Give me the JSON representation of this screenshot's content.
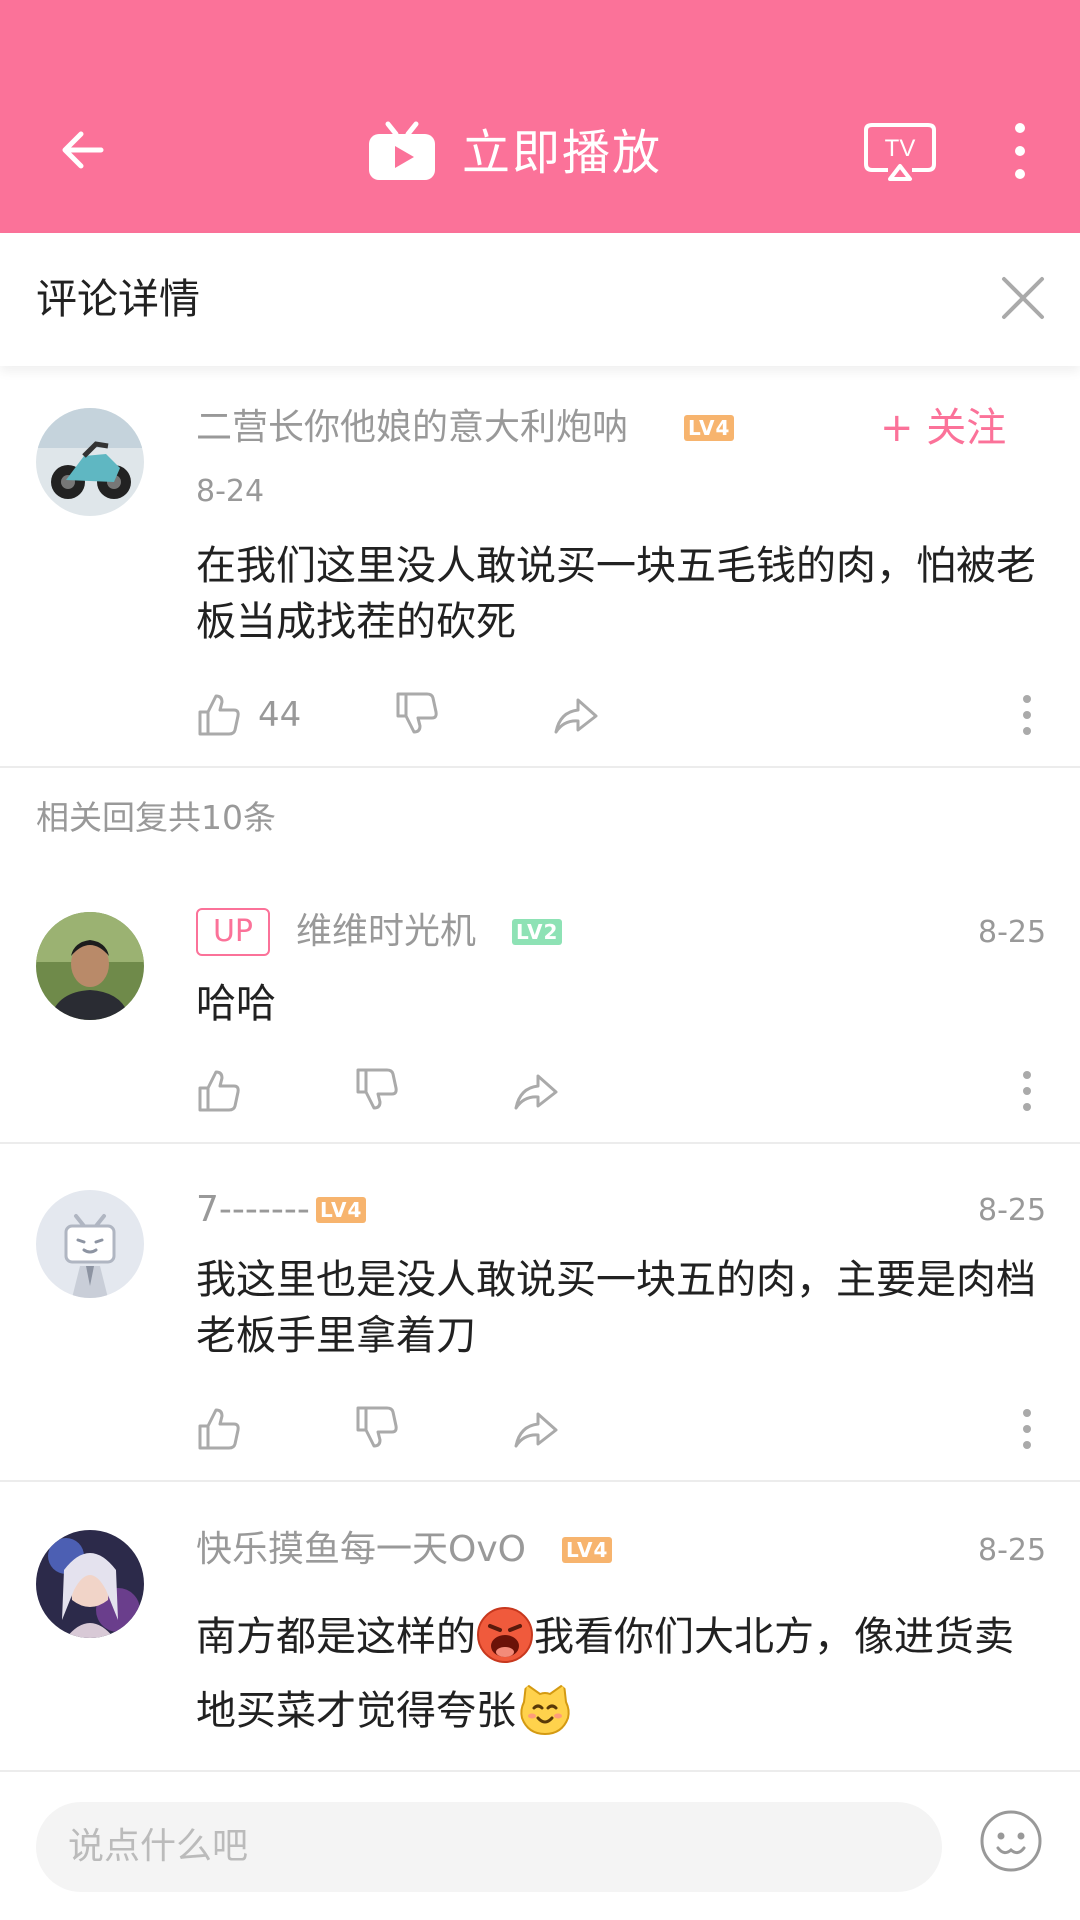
{
  "topbar": {
    "play_label": "立即播放",
    "tv_label": "TV",
    "accent": "#fb7299"
  },
  "header": {
    "title": "评论详情"
  },
  "main_comment": {
    "username": "二营长你他娘的意大利炮呐",
    "level": "LV4",
    "follow_label": "+ 关注",
    "date": "8-24",
    "text": "在我们这里没人敢说买一块五毛钱的肉，怕被老板当成找茬的砍死",
    "likes": "44"
  },
  "replies_header": "相关回复共10条",
  "replies": [
    {
      "badge": "UP",
      "username": "维维时光机",
      "level": "LV2",
      "date": "8-25",
      "text": "哈哈"
    },
    {
      "username": "7-------",
      "level": "LV4",
      "date": "8-25",
      "text": "我这里也是没人敢说买一块五的肉，主要是肉档老板手里拿着刀"
    },
    {
      "username": "快乐摸鱼每一天OvO",
      "level": "LV4",
      "date": "8-25",
      "text_part1": "南方都是这样的",
      "text_part2": "我看你们大北方，像进货卖地买菜才觉得夸张"
    }
  ],
  "composer": {
    "placeholder": "说点什么吧"
  },
  "icons": {
    "back": "arrow-left-icon",
    "play": "tv-play-icon",
    "cast": "tv-cast-icon",
    "more": "more-vertical-icon",
    "close": "close-icon",
    "like": "thumb-up-icon",
    "dislike": "thumb-down-icon",
    "share": "share-icon",
    "emoji": "emoji-icon"
  }
}
